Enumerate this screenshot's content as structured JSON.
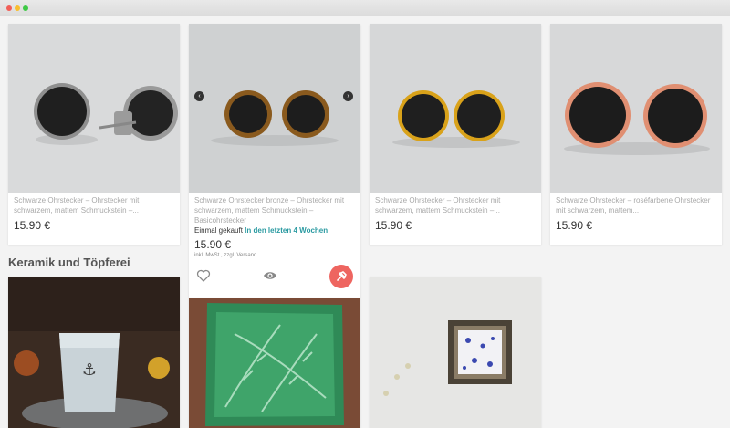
{
  "window": {
    "controls": [
      "close",
      "minimize",
      "zoom"
    ]
  },
  "products": [
    {
      "title": "Schwarze Ohrstecker – Ohrstecker mit schwarzem, mattem Schmuckstein –...",
      "price": "15.90 €"
    },
    {
      "title": "Schwarze Ohrstecker bronze – Ohrstecker mit schwarzem, mattem Schmuckstein – Basicohrstecker",
      "price": "15.90 €",
      "bought_prefix": "Einmal gekauft",
      "bought_highlight": "In den letzten 4 Wochen",
      "vat_note": "inkl. MwSt., zzgl. Versand",
      "actions": {
        "favorite_icon": "heart-icon",
        "view_icon": "eye-icon",
        "pin_icon": "pin-icon"
      },
      "carousel": {
        "prev": "‹",
        "next": "›"
      }
    },
    {
      "title": "Schwarze Ohrstecker – Ohrstecker mit schwarzem, mattem Schmuckstein –...",
      "price": "15.90 €"
    },
    {
      "title": "Schwarze Ohrstecker – roséfarbene Ohrstecker mit schwarzem, mattem...",
      "price": "15.90 €"
    }
  ],
  "section_title": "Keramik und Töpferei",
  "colors": {
    "accent_teal": "#2a9aa1",
    "pin_red": "#ee6560",
    "bronze": "#8a5a1e",
    "gold": "#d9a21a",
    "rose_gold": "#e08f72",
    "silver": "#8c8c8c"
  }
}
